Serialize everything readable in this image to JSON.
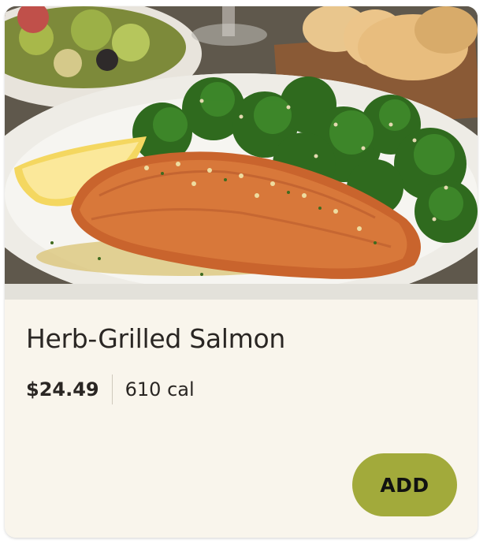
{
  "item": {
    "name": "Herb-Grilled Salmon",
    "price": "$24.49",
    "calories": "610 cal",
    "add_label": "ADD"
  },
  "colors": {
    "card_background": "#f9f5ec",
    "add_button": "#a2aa3b",
    "text": "#2a2623"
  }
}
